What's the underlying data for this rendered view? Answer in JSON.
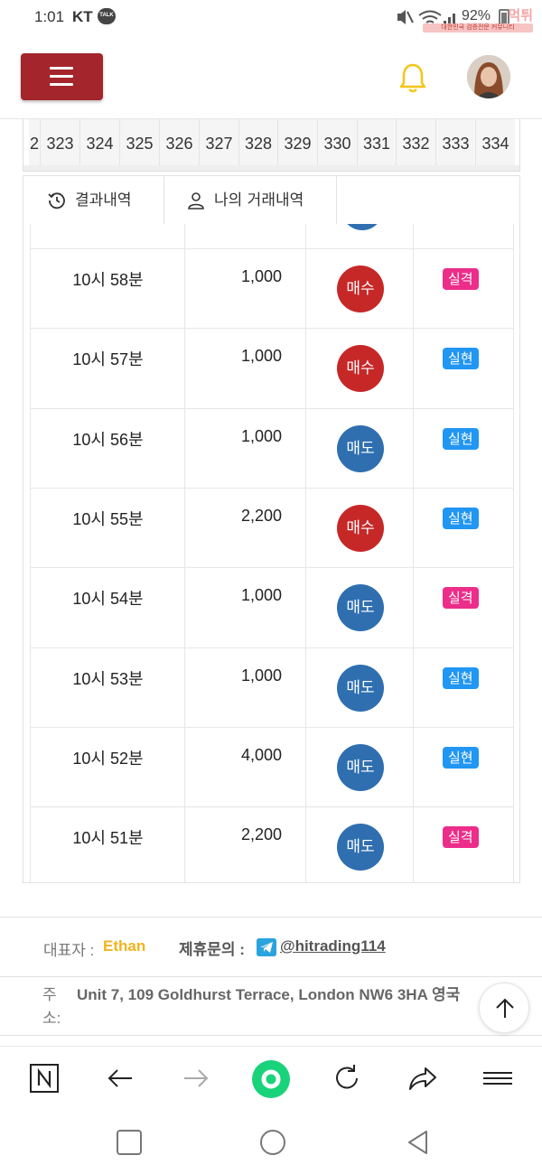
{
  "status_bar": {
    "time": "1:01",
    "carrier": "KT",
    "talk_badge": "TALK",
    "battery": "92%",
    "watermark_logo": "먹튀",
    "watermark_sub": "대한민국 검증전문 커뮤니티"
  },
  "header": {
    "menu_icon": "hamburger-icon",
    "notification_icon": "bell-icon",
    "accent_color": "#a4252b"
  },
  "number_strip": [
    "2",
    "323",
    "324",
    "325",
    "326",
    "327",
    "328",
    "329",
    "330",
    "331",
    "332",
    "333",
    "334"
  ],
  "tabs": [
    {
      "label": "결과내역",
      "icon": "history-icon",
      "active": false
    },
    {
      "label": "나의 거래내역",
      "icon": "user-icon",
      "active": true
    }
  ],
  "trades": [
    {
      "time": "10시 58분",
      "amount": "1,000",
      "type": "매수",
      "kind": "buy",
      "result": "실격",
      "result_kind": "fail"
    },
    {
      "time": "10시 57분",
      "amount": "1,000",
      "type": "매수",
      "kind": "buy",
      "result": "실현",
      "result_kind": "win"
    },
    {
      "time": "10시 56분",
      "amount": "1,000",
      "type": "매도",
      "kind": "sell",
      "result": "실현",
      "result_kind": "win"
    },
    {
      "time": "10시 55분",
      "amount": "2,200",
      "type": "매수",
      "kind": "buy",
      "result": "실현",
      "result_kind": "win"
    },
    {
      "time": "10시 54분",
      "amount": "1,000",
      "type": "매도",
      "kind": "sell",
      "result": "실격",
      "result_kind": "fail"
    },
    {
      "time": "10시 53분",
      "amount": "1,000",
      "type": "매도",
      "kind": "sell",
      "result": "실현",
      "result_kind": "win"
    },
    {
      "time": "10시 52분",
      "amount": "4,000",
      "type": "매도",
      "kind": "sell",
      "result": "실현",
      "result_kind": "win"
    },
    {
      "time": "10시 51분",
      "amount": "2,200",
      "type": "매도",
      "kind": "sell",
      "result": "실격",
      "result_kind": "fail"
    }
  ],
  "colors": {
    "buy": "#c62828",
    "sell": "#2f6fb0",
    "fail_badge": "#ec2d89",
    "win_badge": "#2196f3",
    "representative": "#f1b41b"
  },
  "footer": {
    "representative_label": "대표자 :",
    "representative_name": "Ethan",
    "contact_label": "제휴문의 :",
    "contact_icon": "telegram-icon",
    "contact_handle": " @hitrading114",
    "address_label": "주소:",
    "address": "Unit 7, 109 Goldhurst Terrace, London NW6 3HA 영국"
  },
  "browser_bar": [
    "naver-n-icon",
    "back-arrow-icon",
    "forward-arrow-icon",
    "home-circle-icon",
    "refresh-icon",
    "share-icon",
    "menu-icon"
  ],
  "system_nav": [
    "recent-apps-icon",
    "home-icon",
    "back-icon"
  ]
}
